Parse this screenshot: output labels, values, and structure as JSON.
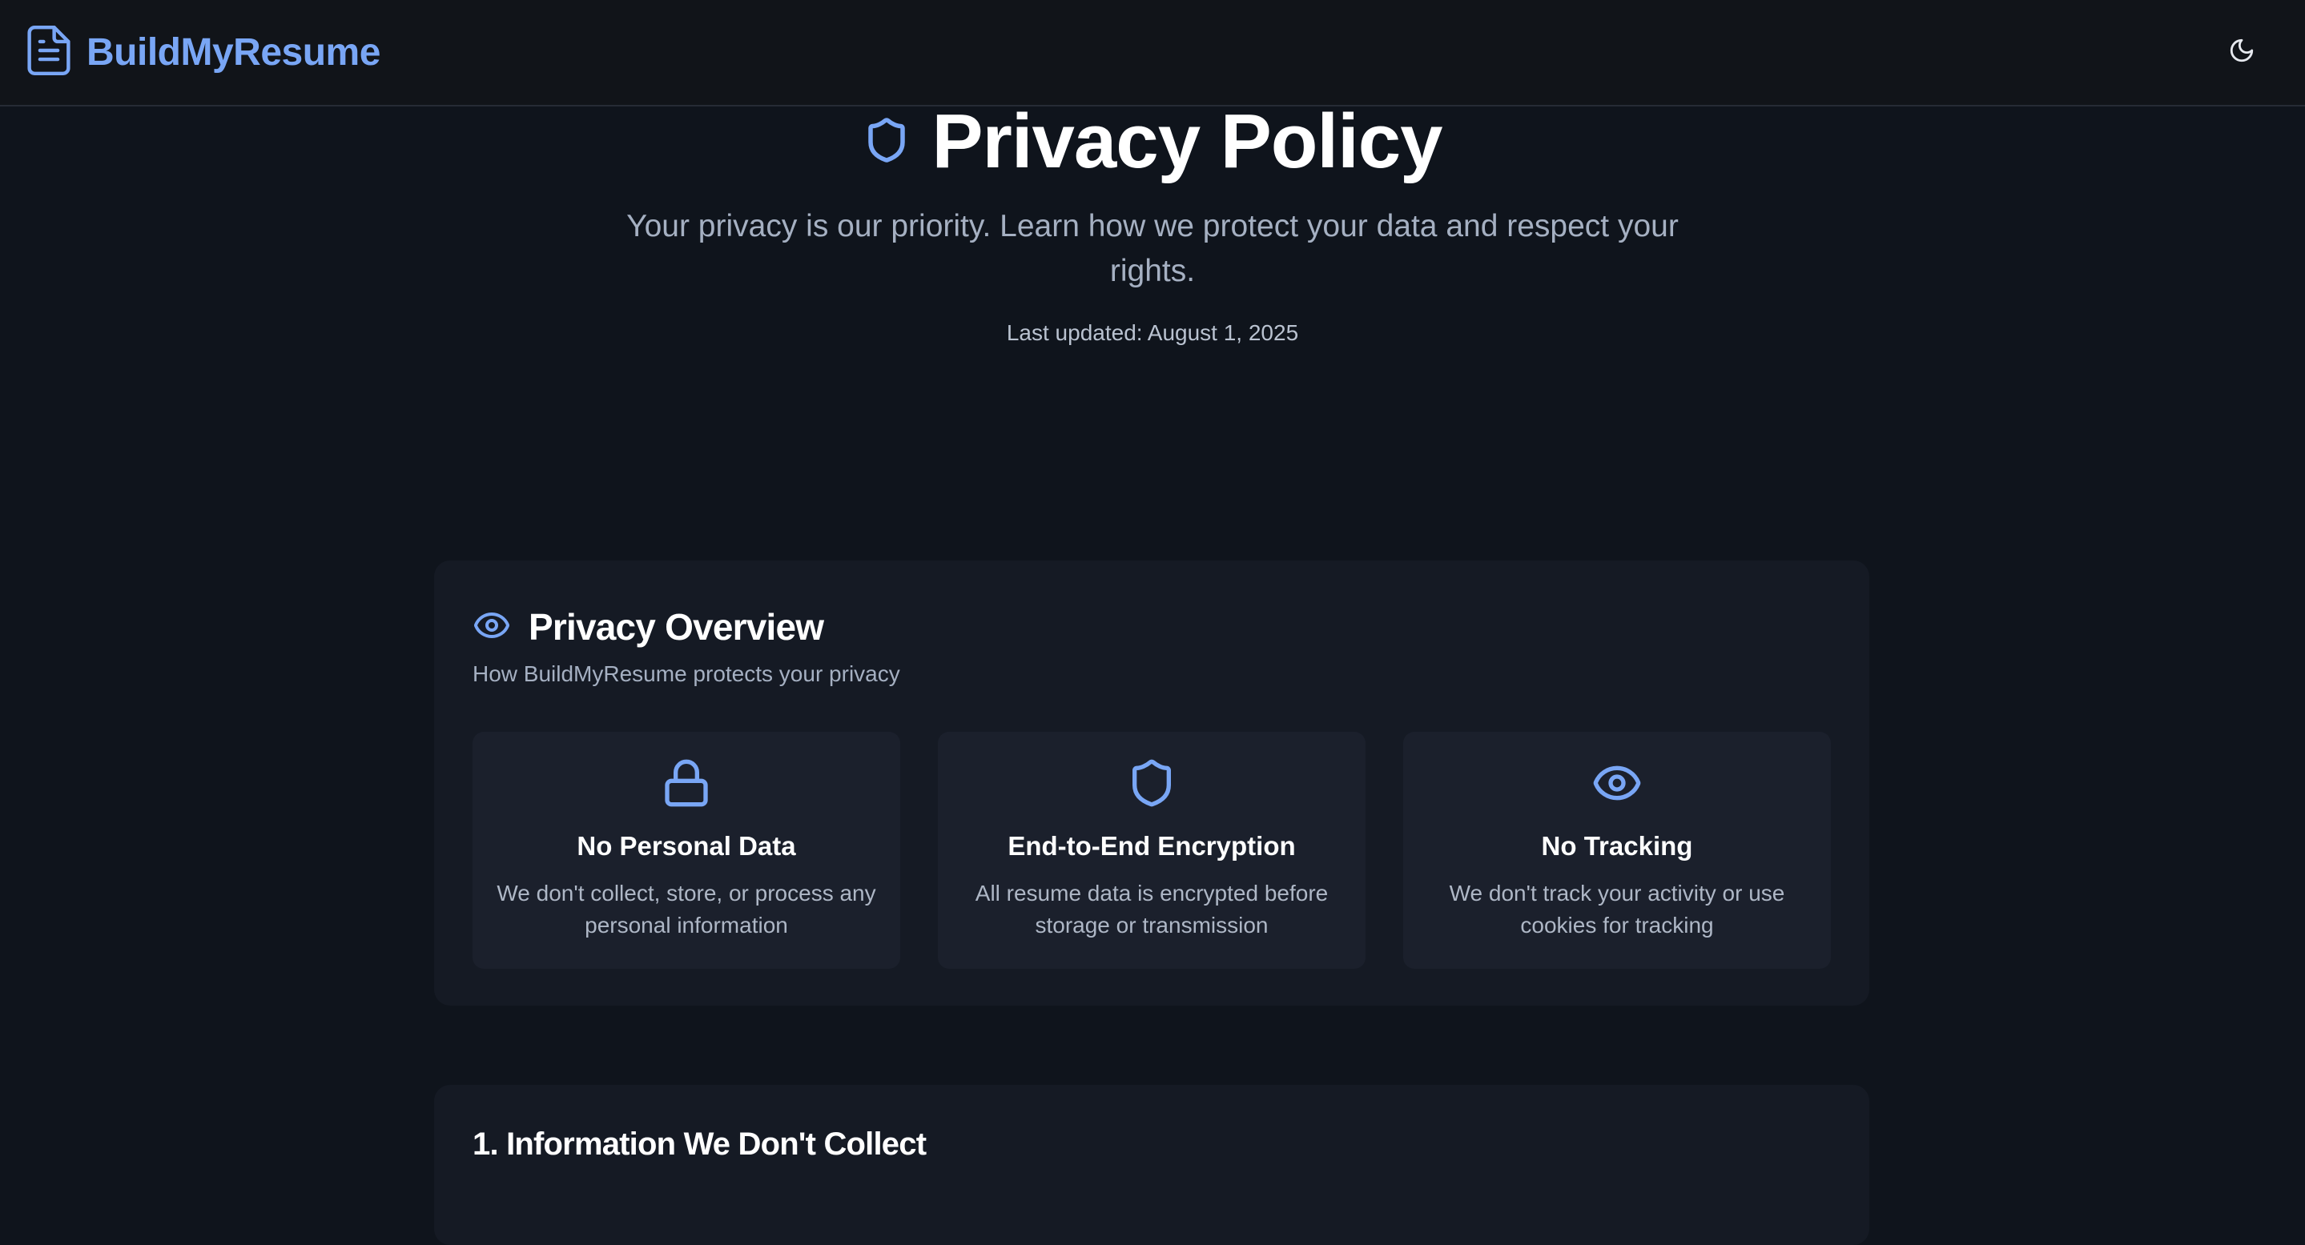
{
  "header": {
    "brand_name": "BuildMyResume",
    "brand_icon": "file-text-icon",
    "theme_toggle_icon": "moon-icon"
  },
  "hero": {
    "icon": "shield-icon",
    "title": "Privacy Policy",
    "subtitle": "Your privacy is our priority. Learn how we protect your data and respect your rights.",
    "last_updated": "Last updated: August 1, 2025"
  },
  "overview": {
    "icon": "eye-icon",
    "title": "Privacy Overview",
    "description": "How BuildMyResume protects your privacy",
    "features": [
      {
        "icon": "lock-icon",
        "title": "No Personal Data",
        "description": "We don't collect, store, or process any personal information"
      },
      {
        "icon": "shield-icon",
        "title": "End-to-End Encryption",
        "description": "All resume data is encrypted before storage or transmission"
      },
      {
        "icon": "eye-icon",
        "title": "No Tracking",
        "description": "We don't track your activity or use cookies for tracking"
      }
    ]
  },
  "sections": [
    {
      "title": "1. Information We Don't Collect"
    }
  ],
  "colors": {
    "accent": "#79a6f5",
    "background": "#0f141c",
    "card": "#151a24",
    "feature_card": "#1b202c"
  }
}
